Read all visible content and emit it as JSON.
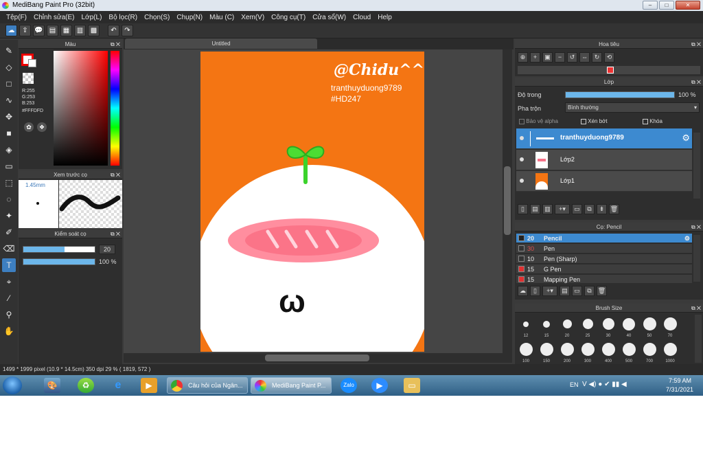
{
  "window": {
    "title": "MediBang Paint Pro (32bit)",
    "minimize": "–",
    "maximize": "□",
    "close": "✕"
  },
  "menu": [
    "Tệp(F)",
    "Chỉnh sửa(E)",
    "Lớp(L)",
    "Bộ lọc(R)",
    "Chọn(S)",
    "Chụp(N)",
    "Màu (C)",
    "Xem(V)",
    "Công cụ(T)",
    "Cửa sổ(W)",
    "Cloud",
    "Help"
  ],
  "color_panel": {
    "title": "Màu",
    "r": "R:255",
    "g": "G:253",
    "b": "B:253",
    "hex": "#FFFDFD"
  },
  "brush_preview": {
    "title": "Xem trước cọ",
    "size": "1.45mm"
  },
  "brush_control": {
    "title": "Kiểm soát cọ",
    "size_value": "20",
    "opacity_value": "100 %",
    "size_fraction": 0.58,
    "opacity_fraction": 1.0
  },
  "document": {
    "tab": "Untitled"
  },
  "artwork": {
    "handle": "@Chidu^^",
    "username": "tranthuyduong9789",
    "tag": "#HD247",
    "face": "ω"
  },
  "status": {
    "text": "1499 * 1999 pixel   (10.9 * 14.5cm)   350 dpi   29 %   ( 1819, 572 )"
  },
  "navigator": {
    "title": "Hoa tiêu"
  },
  "layer_panel": {
    "title": "Lớp",
    "opacity_label": "Độ trong",
    "opacity_value": "100 %",
    "opacity_fraction": 1.0,
    "blend_label": "Pha trộn",
    "blend_value": "Bình thường",
    "protect_alpha": "Bảo vệ alpha",
    "clipping": "Xén bớt",
    "lock": "Khóa",
    "layers": [
      {
        "name": "tranthuyduong9789",
        "selected": true
      },
      {
        "name": "Lớp2",
        "selected": false
      },
      {
        "name": "Lớp1",
        "selected": false
      }
    ]
  },
  "brush_panel": {
    "title": "Cọ: Pencil",
    "brushes": [
      {
        "size": "20",
        "name": "Pencil",
        "color": "#222222",
        "selected": true
      },
      {
        "size": "30",
        "name": "Pen",
        "color": "#333333",
        "selected": false
      },
      {
        "size": "10",
        "name": "Pen (Sharp)",
        "color": "#333333",
        "selected": false
      },
      {
        "size": "15",
        "name": "G Pen",
        "color": "#e03030",
        "selected": false
      },
      {
        "size": "15",
        "name": "Mapping Pen",
        "color": "#e03030",
        "selected": false
      }
    ]
  },
  "brush_size_panel": {
    "title": "Brush Size",
    "sizes": [
      "12",
      "15",
      "20",
      "25",
      "30",
      "40",
      "50",
      "70",
      "100",
      "150",
      "200",
      "300",
      "400",
      "500",
      "700",
      "1000"
    ]
  },
  "taskbar": {
    "chrome_label": "Câu hỏi của Ngân...",
    "medibang_label": "MediBang Paint P...",
    "zalo": "Zalo",
    "lang": "EN",
    "time": "7:59 AM",
    "date": "7/31/2021"
  }
}
